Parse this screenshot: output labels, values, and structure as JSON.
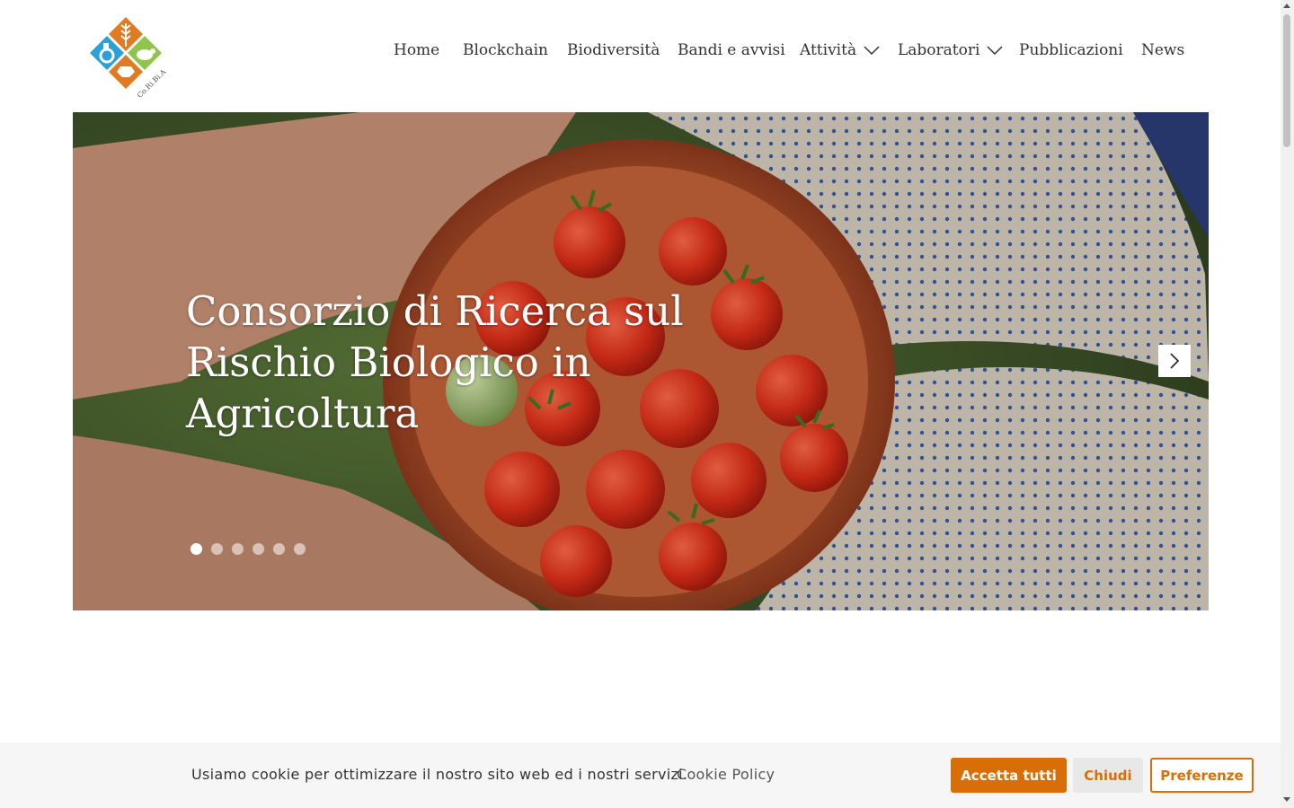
{
  "logo": {
    "text": "Co.Ri.Bi.A",
    "colors": {
      "orange": "#e07b24",
      "blue": "#2a9fd8",
      "green": "#8ec54a"
    }
  },
  "nav": {
    "items": [
      {
        "label": "Home",
        "has_dropdown": false
      },
      {
        "label": "Blockchain",
        "has_dropdown": false
      },
      {
        "label": "Biodiversità",
        "has_dropdown": false
      },
      {
        "label": "Bandi e avvisi",
        "has_dropdown": false
      },
      {
        "label": "Attività",
        "has_dropdown": true
      },
      {
        "label": "Laboratori",
        "has_dropdown": true
      },
      {
        "label": "Pubblicazioni",
        "has_dropdown": false
      },
      {
        "label": "News",
        "has_dropdown": false
      }
    ]
  },
  "hero": {
    "title": "Consorzio di Ricerca sul Rischio Biologico in Agricoltura",
    "slide_count": 6,
    "active_slide": 1
  },
  "cookie": {
    "message": "Usiamo cookie per ottimizzare il nostro sito web ed i nostri servizi.",
    "policy_link": "Cookie Policy",
    "accept_label": "Accetta tutti",
    "close_label": "Chiudi",
    "prefs_label": "Preferenze",
    "accent": "#d86f06"
  }
}
